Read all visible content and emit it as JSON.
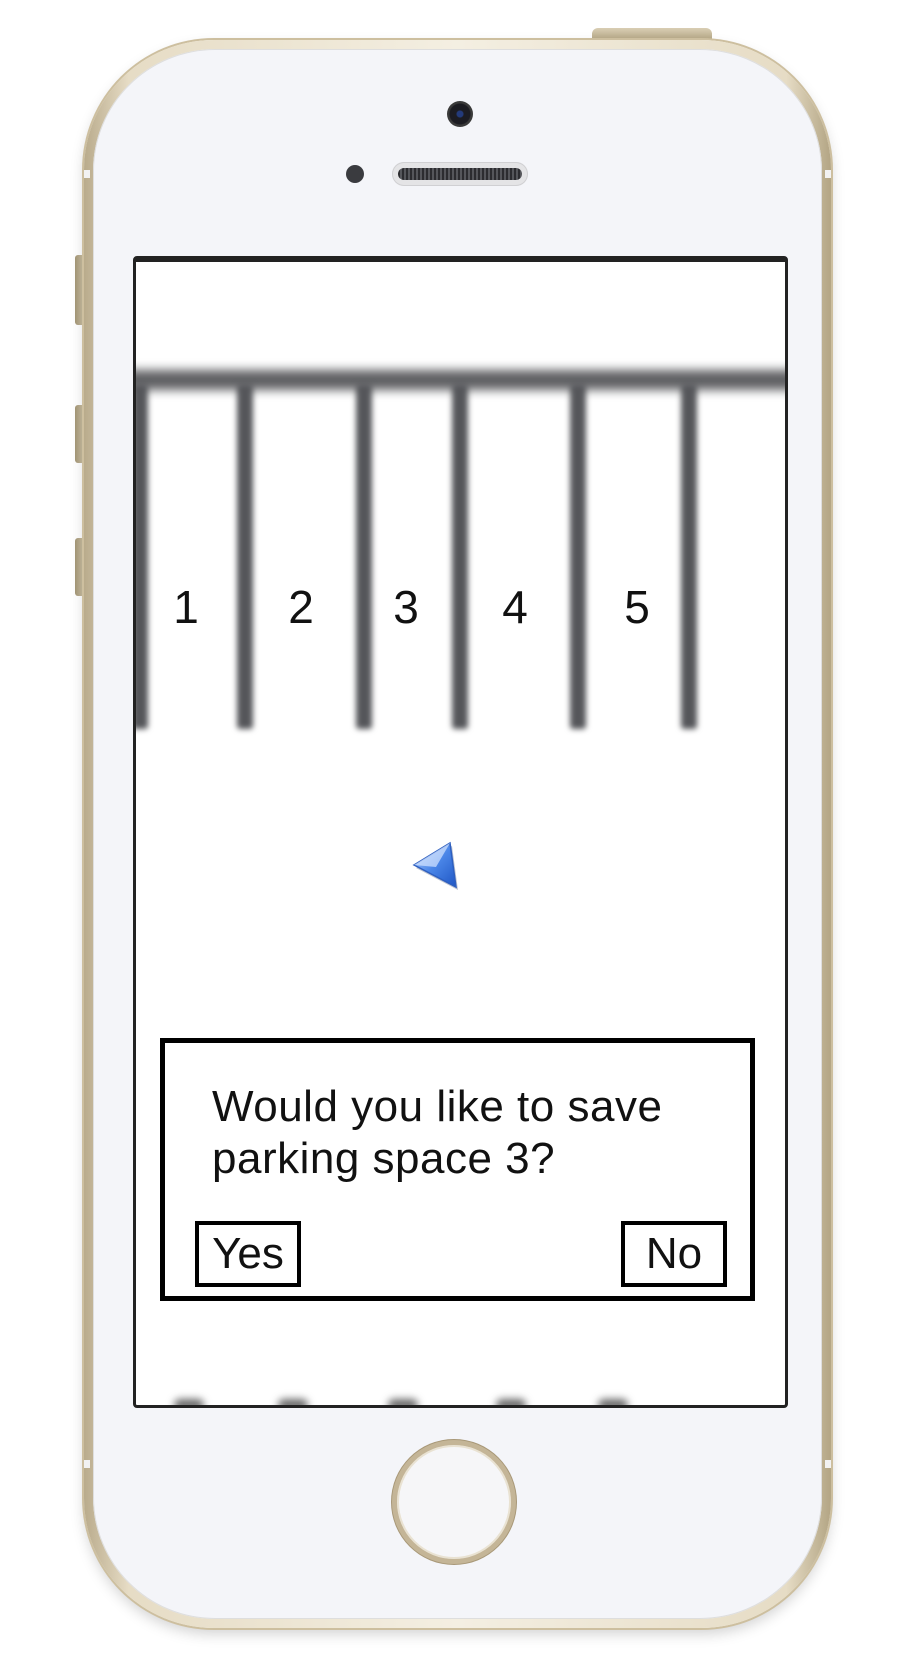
{
  "device": {
    "model": "iphone-gold",
    "frame_color": "#e6dcc5",
    "face_color": "#f4f5f9"
  },
  "parking_lot": {
    "spaces": [
      {
        "label": "1"
      },
      {
        "label": "2"
      },
      {
        "label": "3"
      },
      {
        "label": "4"
      },
      {
        "label": "5"
      }
    ],
    "line_color": "#55565a"
  },
  "location_marker": {
    "icon": "navigation-arrow-icon",
    "color": "#4a86e8"
  },
  "dialog": {
    "message_line1": "Would you like to save",
    "message_line2": "parking space 3?",
    "yes_label": "Yes",
    "no_label": "No"
  }
}
